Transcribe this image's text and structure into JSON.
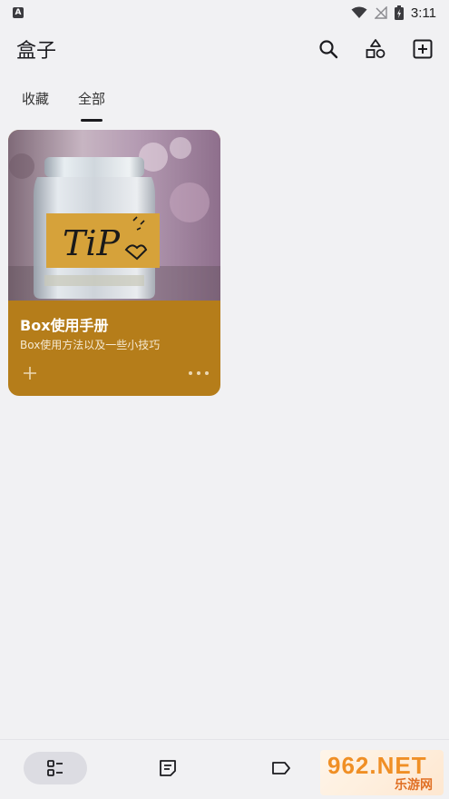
{
  "status_bar": {
    "badge": "A",
    "time": "3:11"
  },
  "app_bar": {
    "title": "盒子",
    "actions": [
      "search-icon",
      "shapes-icon",
      "add-box-icon"
    ]
  },
  "tabs": [
    {
      "label": "收藏",
      "active": false
    },
    {
      "label": "全部",
      "active": true
    }
  ],
  "cards": [
    {
      "title": "Box使用手册",
      "description": "Box使用方法以及一些小技巧",
      "cover_text": "TiP",
      "color": "#b57d1a"
    }
  ],
  "bottom_nav": {
    "items": [
      "dashboard-icon",
      "note-icon",
      "label-icon"
    ],
    "active_index": 0
  },
  "watermark": {
    "top": "962.NET",
    "bottom": "乐游网"
  }
}
